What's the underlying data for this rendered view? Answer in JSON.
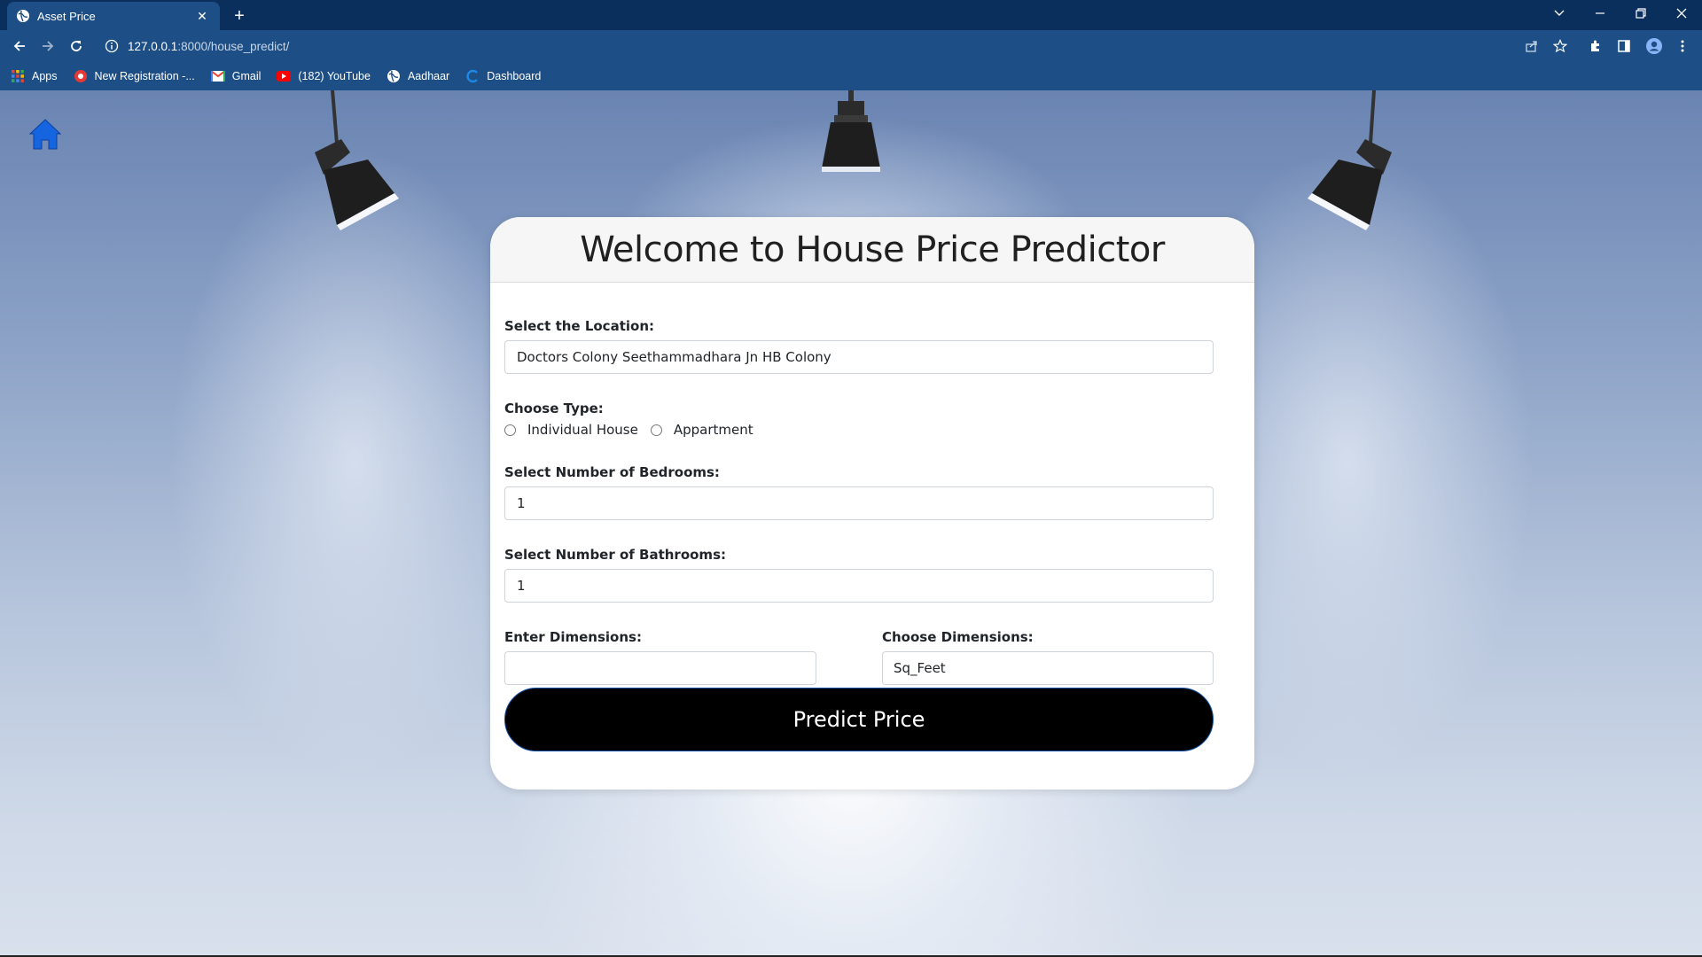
{
  "browser": {
    "tab_title": "Asset Price",
    "tab_close": "✕",
    "new_tab": "+",
    "url_host": "127.0.0.1",
    "url_path": ":8000/house_predict/",
    "bookmarks": [
      {
        "label": "Apps",
        "icon": "apps-grid-icon"
      },
      {
        "label": "New Registration -...",
        "icon": "registration-icon"
      },
      {
        "label": "Gmail",
        "icon": "gmail-icon"
      },
      {
        "label": "(182) YouTube",
        "icon": "youtube-icon"
      },
      {
        "label": "Aadhaar",
        "icon": "aadhaar-icon"
      },
      {
        "label": "Dashboard",
        "icon": "dashboard-icon"
      }
    ]
  },
  "page": {
    "title": "Welcome to House Price Predictor",
    "location": {
      "label": "Select the Location:",
      "value": "Doctors Colony Seethammadhara Jn HB Colony"
    },
    "type": {
      "label": "Choose Type:",
      "options": [
        "Individual House",
        "Appartment"
      ]
    },
    "bedrooms": {
      "label": "Select Number of Bedrooms:",
      "value": "1"
    },
    "bathrooms": {
      "label": "Select Number of Bathrooms:",
      "value": "1"
    },
    "dimensions": {
      "label": "Enter Dimensions:",
      "value": ""
    },
    "dimension_unit": {
      "label": "Choose Dimensions:",
      "value": "Sq_Feet"
    },
    "submit_label": "Predict Price"
  },
  "colors": {
    "tab_strip": "#0b2f5c",
    "toolbar": "#1d4f86",
    "button": "#000000",
    "home_icon": "#1565e0"
  }
}
